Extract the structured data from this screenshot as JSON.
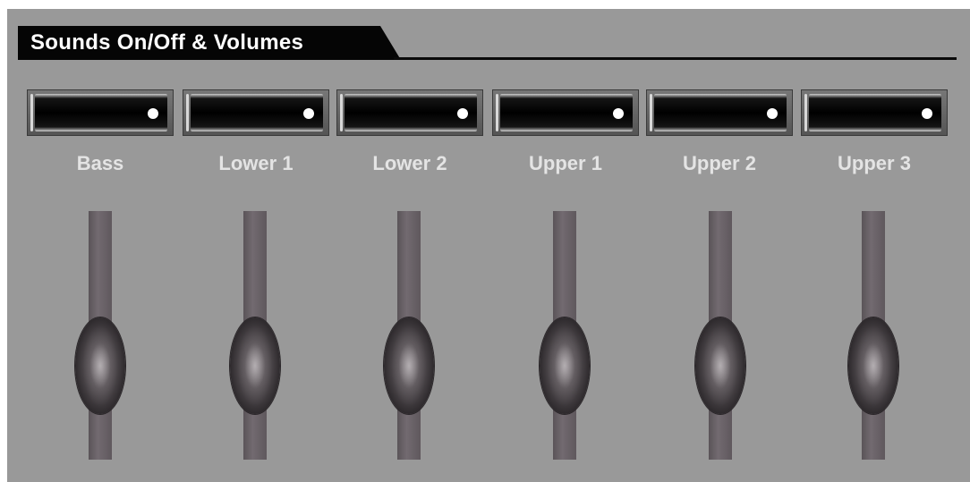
{
  "panel": {
    "title": "Sounds On/Off & Volumes"
  },
  "channels": [
    {
      "label": "Bass",
      "on": true,
      "volume": 0.3
    },
    {
      "label": "Lower 1",
      "on": true,
      "volume": 0.3
    },
    {
      "label": "Lower 2",
      "on": true,
      "volume": 0.3
    },
    {
      "label": "Upper 1",
      "on": true,
      "volume": 0.3
    },
    {
      "label": "Upper 2",
      "on": true,
      "volume": 0.3
    },
    {
      "label": "Upper 3",
      "on": true,
      "volume": 0.3
    }
  ],
  "colors": {
    "panel_background": "#999999",
    "switch_indicator": "#ffffff",
    "label_text": "#e4e4e4"
  }
}
